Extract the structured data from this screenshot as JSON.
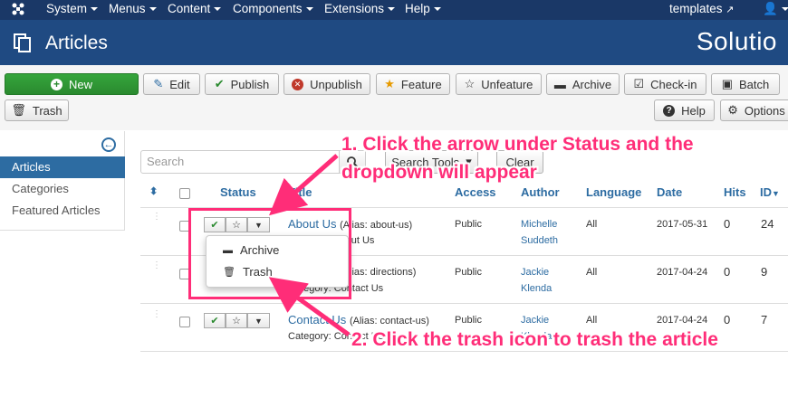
{
  "topnav": {
    "menus": [
      "System",
      "Menus",
      "Content",
      "Components",
      "Extensions",
      "Help"
    ],
    "site_link": "templates"
  },
  "header": {
    "title": "Articles",
    "brand": "Solutio"
  },
  "toolbar": {
    "new": "New",
    "edit": "Edit",
    "publish": "Publish",
    "unpublish": "Unpublish",
    "feature": "Feature",
    "unfeature": "Unfeature",
    "archive": "Archive",
    "checkin": "Check-in",
    "batch": "Batch",
    "trash": "Trash",
    "help": "Help",
    "options": "Options"
  },
  "sidebar": {
    "items": [
      "Articles",
      "Categories",
      "Featured Articles"
    ]
  },
  "search": {
    "placeholder": "Search",
    "tools": "Search Tools",
    "clear": "Clear"
  },
  "table": {
    "headers": {
      "status": "Status",
      "title": "Title",
      "access": "Access",
      "author": "Author",
      "language": "Language",
      "date": "Date",
      "hits": "Hits",
      "id": "ID"
    },
    "rows": [
      {
        "title": "About Us",
        "alias": "(Alias: about-us)",
        "category": "Category: About Us",
        "access": "Public",
        "author1": "Michelle",
        "author2": "Suddeth",
        "language": "All",
        "date": "2017-05-31",
        "hits": "0",
        "id": "24"
      },
      {
        "title": "",
        "alias": "(Alias: directions)",
        "category": "Category: Contact Us",
        "access": "Public",
        "author1": "Jackie",
        "author2": "Klenda",
        "language": "All",
        "date": "2017-04-24",
        "hits": "0",
        "id": "9"
      },
      {
        "title": "Contact Us",
        "alias": "(Alias: contact-us)",
        "category": "Category: Contact Us",
        "access": "Public",
        "author1": "Jackie",
        "author2": "Klenda",
        "language": "All",
        "date": "2017-04-24",
        "hits": "0",
        "id": "7"
      }
    ]
  },
  "dropdown": {
    "items": [
      "Archive",
      "Trash"
    ]
  },
  "annotations": {
    "step1_line1": "1. Click the arrow under Status and the",
    "step1_line2": "dropdown will appear",
    "step2": "2. Click the trash icon to trash the article"
  },
  "colors": {
    "annotation": "#ff2d78",
    "nav": "#1a3867",
    "header": "#1f4a82",
    "link": "#2d6ca2",
    "new_button": "#2a8a2f"
  }
}
